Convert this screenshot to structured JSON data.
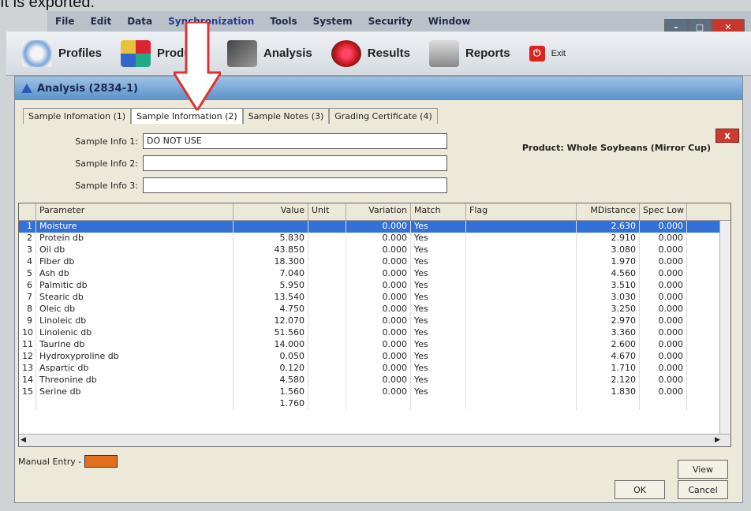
{
  "caption": "It is exported.",
  "menu": [
    "File",
    "Edit",
    "Data",
    "Synchronization",
    "Tools",
    "System",
    "Security",
    "Window"
  ],
  "window_controls": {
    "min": "–",
    "max": "▢",
    "close": "✕"
  },
  "toolbar": [
    {
      "label": "Profiles",
      "icon": "profiles-icon"
    },
    {
      "label": "Products",
      "icon": "products-icon"
    },
    {
      "label": "Analysis",
      "icon": "analysis-icon"
    },
    {
      "label": "Results",
      "icon": "results-icon"
    },
    {
      "label": "Reports",
      "icon": "reports-icon"
    },
    {
      "label": "Exit",
      "icon": "exit-icon"
    }
  ],
  "dialog": {
    "title": "Analysis (2834-1)",
    "close_label": "x",
    "tabs": [
      "Sample Infomation (1)",
      "Sample Information (2)",
      "Sample Notes (3)",
      "Grading Certificate (4)"
    ],
    "product": "Product: Whole Soybeans (Mirror Cup)",
    "sample_info_1_label": "Sample Info 1:",
    "sample_info_1_value": "DO NOT USE",
    "sample_info_2_label": "Sample Info 2:",
    "sample_info_2_value": "",
    "sample_info_3_label": "Sample Info 3:",
    "sample_info_3_value": "",
    "columns": [
      "",
      "Parameter",
      "Value",
      "Unit",
      "Variation",
      "Match",
      "Flag",
      "MDistance",
      "Spec Low"
    ],
    "rows": [
      {
        "n": "1",
        "param": "Moisture",
        "value": "",
        "unit": "",
        "var": "0.000",
        "match": "Yes",
        "md": "2.630",
        "sl": "0.000",
        "selected": true
      },
      {
        "n": "2",
        "param": "Protein db",
        "value": "5.830",
        "unit": "",
        "var": "0.000",
        "match": "Yes",
        "md": "2.910",
        "sl": "0.000"
      },
      {
        "n": "3",
        "param": "Oil db",
        "value": "43.850",
        "unit": "",
        "var": "0.000",
        "match": "Yes",
        "md": "3.080",
        "sl": "0.000"
      },
      {
        "n": "4",
        "param": "Fiber db",
        "value": "18.300",
        "unit": "",
        "var": "0.000",
        "match": "Yes",
        "md": "1.970",
        "sl": "0.000"
      },
      {
        "n": "5",
        "param": "Ash db",
        "value": "7.040",
        "unit": "",
        "var": "0.000",
        "match": "Yes",
        "md": "4.560",
        "sl": "0.000"
      },
      {
        "n": "6",
        "param": "Palmitic db",
        "value": "5.950",
        "unit": "",
        "var": "0.000",
        "match": "Yes",
        "md": "3.510",
        "sl": "0.000"
      },
      {
        "n": "7",
        "param": "Stearic db",
        "value": "13.540",
        "unit": "",
        "var": "0.000",
        "match": "Yes",
        "md": "3.030",
        "sl": "0.000"
      },
      {
        "n": "8",
        "param": "Oleic db",
        "value": "4.750",
        "unit": "",
        "var": "0.000",
        "match": "Yes",
        "md": "3.250",
        "sl": "0.000"
      },
      {
        "n": "9",
        "param": "Linoleic db",
        "value": "12.070",
        "unit": "",
        "var": "0.000",
        "match": "Yes",
        "md": "2.970",
        "sl": "0.000"
      },
      {
        "n": "10",
        "param": "Linolenic db",
        "value": "51.560",
        "unit": "",
        "var": "0.000",
        "match": "Yes",
        "md": "3.360",
        "sl": "0.000"
      },
      {
        "n": "11",
        "param": "Taurine db",
        "value": "14.000",
        "unit": "",
        "var": "0.000",
        "match": "Yes",
        "md": "2.600",
        "sl": "0.000"
      },
      {
        "n": "12",
        "param": "Hydroxyproline db",
        "value": "0.050",
        "unit": "",
        "var": "0.000",
        "match": "Yes",
        "md": "4.670",
        "sl": "0.000"
      },
      {
        "n": "13",
        "param": "Aspartic db",
        "value": "0.120",
        "unit": "",
        "var": "0.000",
        "match": "Yes",
        "md": "1.710",
        "sl": "0.000"
      },
      {
        "n": "14",
        "param": "Threonine db",
        "value": "4.580",
        "unit": "",
        "var": "0.000",
        "match": "Yes",
        "md": "2.120",
        "sl": "0.000"
      },
      {
        "n": "15",
        "param": "Serine db",
        "value": "1.560",
        "unit": "",
        "var": "0.000",
        "match": "Yes",
        "md": "1.830",
        "sl": "0.000"
      },
      {
        "n": "",
        "param": "",
        "value": "1.760",
        "unit": "",
        "var": "",
        "match": "",
        "md": "",
        "sl": ""
      }
    ],
    "manual_entry_label": "Manual Entry -",
    "manual_entry_color": "#e07020",
    "view_button": "View",
    "ok_button": "OK",
    "cancel_button": "Cancel"
  }
}
